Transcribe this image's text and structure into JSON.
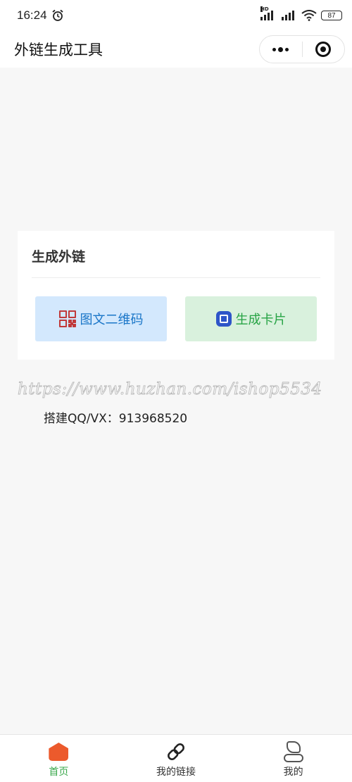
{
  "status_bar": {
    "time": "16:24",
    "alarm_icon": "alarm-clock-icon",
    "network_label": "HD",
    "battery": "87"
  },
  "header": {
    "title": "外链生成工具"
  },
  "card": {
    "title": "生成外链",
    "buttons": [
      {
        "label": "图文二维码",
        "icon": "qr-code-icon",
        "color": "#1a76c8",
        "bg": "#d3e8fd"
      },
      {
        "label": "生成卡片",
        "icon": "card-icon",
        "color": "#26a344",
        "bg": "#d9f1dd"
      }
    ]
  },
  "watermark": "https://www.huzhan.com/ishop5534",
  "contact": "搭建QQ/VX：913968520",
  "tab_bar": {
    "items": [
      {
        "label": "首页",
        "icon": "home-icon",
        "active": true
      },
      {
        "label": "我的链接",
        "icon": "link-icon",
        "active": false
      },
      {
        "label": "我的",
        "icon": "person-icon",
        "active": false
      }
    ],
    "active_color": "#3aa84b"
  }
}
